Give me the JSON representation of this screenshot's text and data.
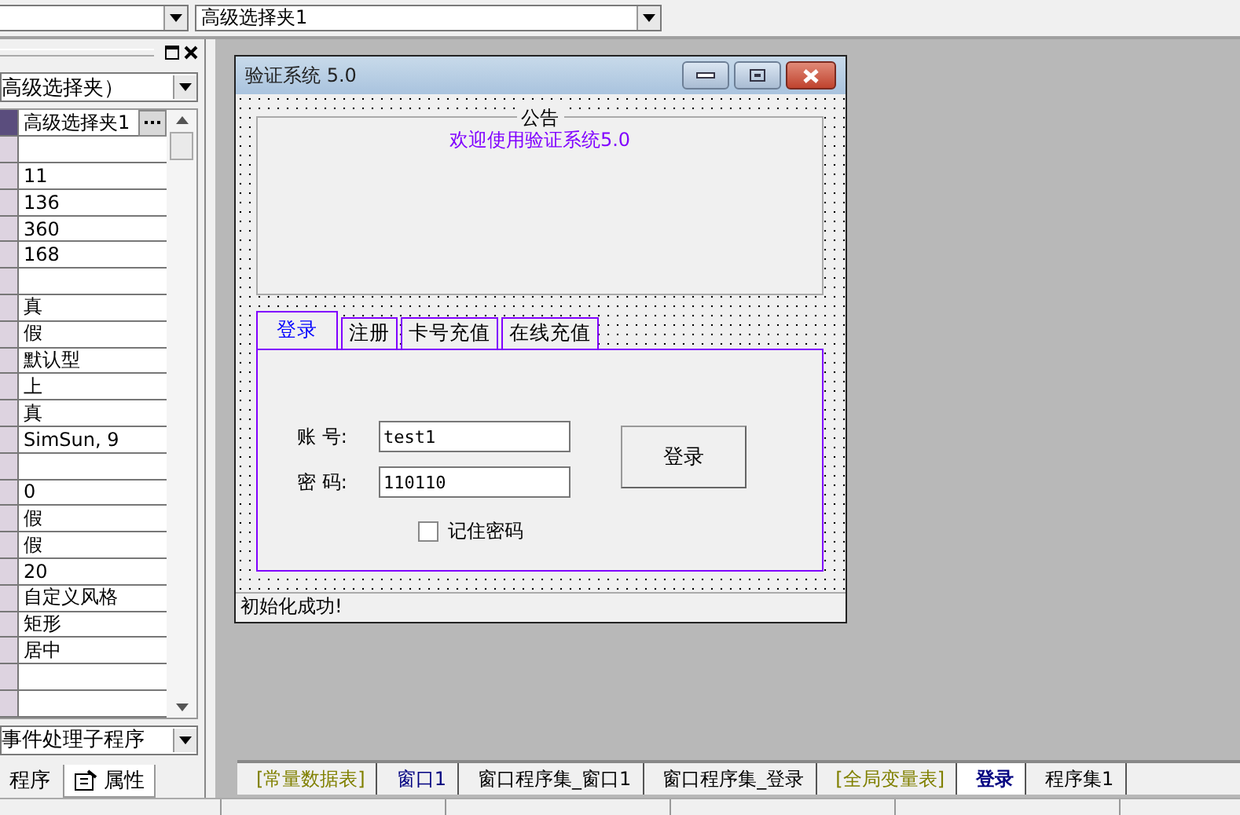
{
  "toolbar": {
    "combo_2": {
      "value": "高级选择夹1"
    }
  },
  "properties_panel": {
    "object_combo": "高级选择夹）",
    "rows": [
      {
        "value": "高级选择夹1",
        "selected": true
      },
      {
        "selected": false
      },
      {
        "value": "11",
        "selected": false
      },
      {
        "value": "136",
        "selected": false
      },
      {
        "value": "360",
        "selected": false
      },
      {
        "value": "168",
        "selected": false
      },
      {
        "selected": false
      },
      {
        "value": "真",
        "selected": false
      },
      {
        "value": "假",
        "selected": false
      },
      {
        "value": "默认型",
        "selected": false
      },
      {
        "value": "上",
        "selected": false
      },
      {
        "value": "真",
        "selected": false
      },
      {
        "value": "SimSun, 9",
        "selected": false
      },
      {
        "selected": false
      },
      {
        "value": "0",
        "selected": false
      },
      {
        "value": "假",
        "selected": false
      },
      {
        "value": "假",
        "selected": false
      },
      {
        "value": "20",
        "selected": false
      },
      {
        "value": "自定义风格",
        "selected": false
      },
      {
        "value": "矩形",
        "selected": false
      },
      {
        "value": "居中",
        "selected": false
      },
      {
        "selected": false
      },
      {
        "selected": false
      }
    ],
    "event_combo": "事件处理子程序",
    "tabs": [
      {
        "label": "程序",
        "selected": false
      },
      {
        "label": "属性",
        "selected": true
      }
    ]
  },
  "form": {
    "title": "验证系统 5.0",
    "notice": {
      "caption": "公告",
      "text": "欢迎使用验证系统5.0"
    },
    "tabs": [
      {
        "label": "登录",
        "selected": true
      },
      {
        "label": "注册",
        "selected": false
      },
      {
        "label": "卡号充值",
        "selected": false
      },
      {
        "label": "在线充值",
        "selected": false
      }
    ],
    "account_label": "账 号:",
    "account_value": "test1",
    "password_label": "密 码:",
    "password_value": "110110",
    "login_button": "登录",
    "remember": {
      "label": "记住密码",
      "checked": false
    },
    "status": "初始化成功!"
  },
  "editor_tabs": [
    {
      "label": "[常量数据表]",
      "color": "#808000",
      "selected": false
    },
    {
      "label": "窗口1",
      "color": "#000080",
      "selected": false
    },
    {
      "label": "窗口程序集_窗口1",
      "color": "#000000",
      "selected": false
    },
    {
      "label": "窗口程序集_登录",
      "color": "#000000",
      "selected": false
    },
    {
      "label": "[全局变量表]",
      "color": "#808000",
      "selected": false
    },
    {
      "label": "登录",
      "color": "#000080",
      "selected": true
    },
    {
      "label": "程序集1",
      "color": "#000000",
      "selected": false
    }
  ]
}
